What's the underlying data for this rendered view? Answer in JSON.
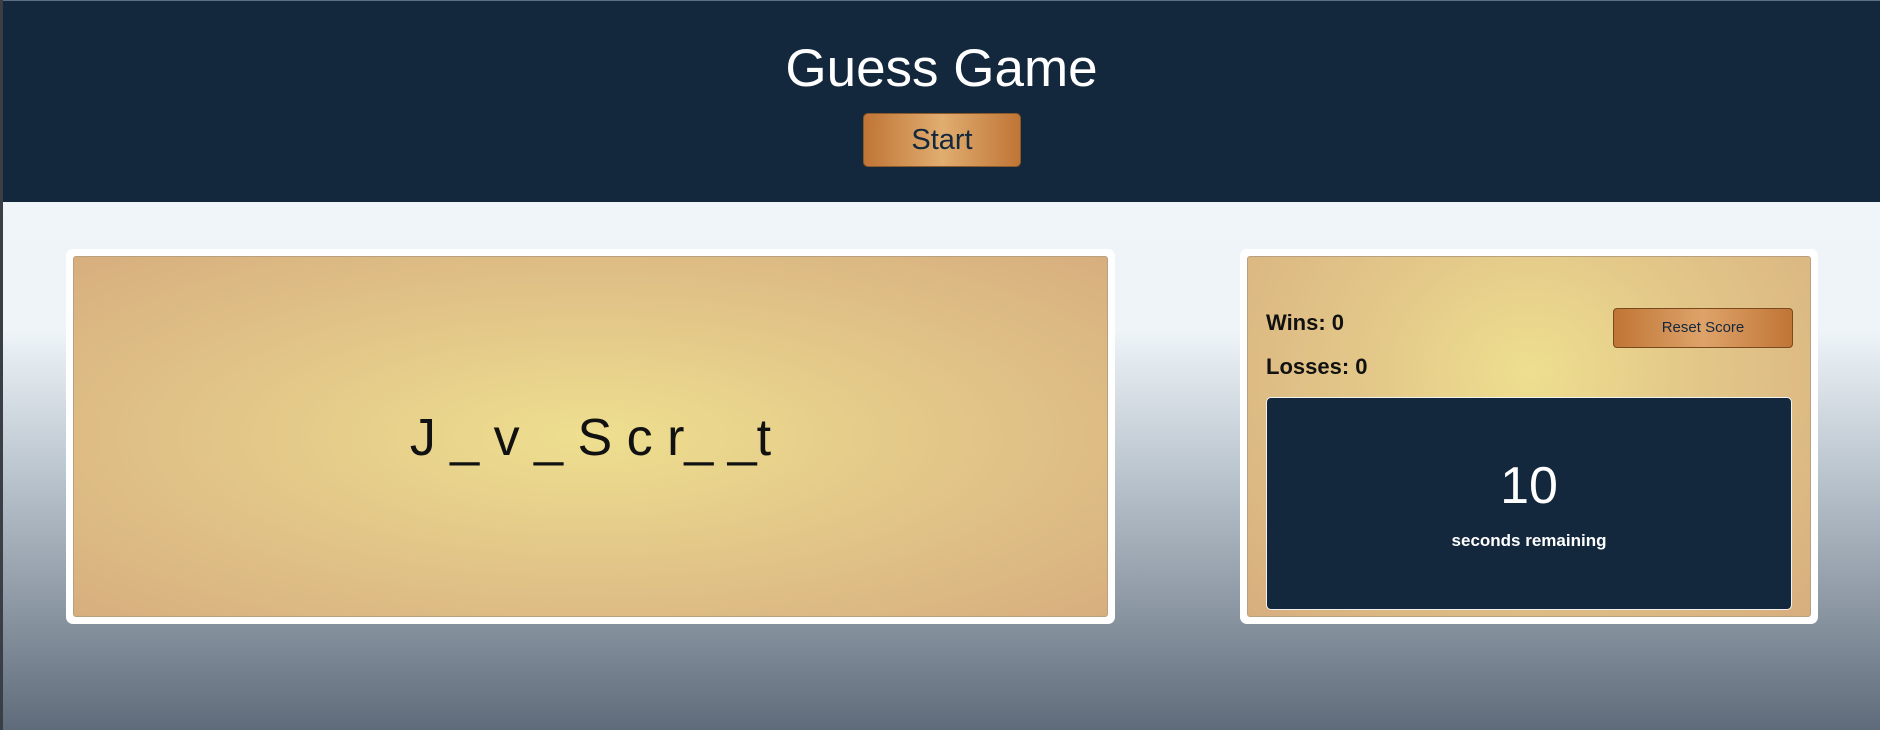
{
  "header": {
    "title": "Guess Game",
    "start_label": "Start"
  },
  "puzzle": {
    "masked_word": "J _ v _ S c r_ _t"
  },
  "scoreboard": {
    "wins_label": "Wins: 0",
    "losses_label": "Losses: 0",
    "reset_label": "Reset Score"
  },
  "timer": {
    "value": "10",
    "label": "seconds remaining"
  },
  "colors": {
    "header_bg": "#14283d",
    "button_copper": "#c07535",
    "card_gold": "#eedf8f"
  }
}
